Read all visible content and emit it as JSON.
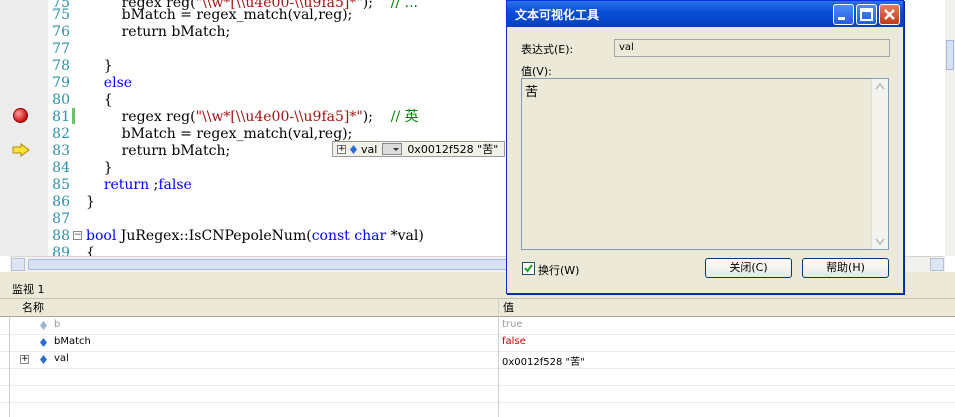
{
  "editor": {
    "lines": [
      {
        "num": "75",
        "pre": "        regex reg(",
        "str": "\"\\\\w*[\\\\u4e00-\\\\u9fa5]*\"",
        "post": ");    ",
        "cm": "// ..."
      },
      {
        "num": "75",
        "pre": "        bMatch = regex_match(val,reg);"
      },
      {
        "num": "76",
        "pre": "        return bMatch;"
      },
      {
        "num": "77",
        "pre": ""
      },
      {
        "num": "78",
        "pre": "    }"
      },
      {
        "num": "79",
        "kw": "    else"
      },
      {
        "num": "80",
        "pre": "    {"
      },
      {
        "num": "81",
        "pre": "        regex reg(",
        "str": "\"\\\\w*[\\\\u4e00-\\\\u9fa5]*\"",
        "post": ");    ",
        "cm": "// 英"
      },
      {
        "num": "82",
        "pre": "        bMatch = regex_match(val,reg);"
      },
      {
        "num": "83",
        "pre": "        return bMatch;"
      },
      {
        "num": "84",
        "pre": "    }"
      },
      {
        "num": "85",
        "kwpre": "    ",
        "kw2": "return",
        "post": " ",
        "kw3": "false",
        "post2": ";"
      },
      {
        "num": "86",
        "pre": "}"
      },
      {
        "num": "87",
        "pre": ""
      },
      {
        "num": "88",
        "kw": "bool",
        "post": " JuRegex::IsCNPepoleNum(",
        "kw2": "const",
        "post2": " ",
        "kw3": "char",
        "post3": " *val)"
      },
      {
        "num": "89",
        "pre": "{"
      }
    ]
  },
  "datatip": {
    "name": "val",
    "value": "0x0012f528 \"苦\""
  },
  "watch": {
    "title": "监视 1",
    "col_name": "名称",
    "col_value": "值",
    "rows": [
      {
        "name": "b",
        "value": "true",
        "expandable": false,
        "grey": true,
        "red": false
      },
      {
        "name": "bMatch",
        "value": "false",
        "expandable": false,
        "grey": false,
        "red": true
      },
      {
        "name": "val",
        "value": "0x0012f528 \"苦\"",
        "expandable": true,
        "grey": false,
        "red": false
      }
    ]
  },
  "dialog": {
    "title": "文本可视化工具",
    "expr_label": "表达式(E):",
    "expr_value": "val",
    "value_label": "值(V):",
    "value_text": "苦",
    "wrap_label": "换行(W)",
    "wrap_checked": true,
    "close_label": "关闭(C)",
    "help_label": "帮助(H)"
  },
  "colors": {
    "title_bar": "#0a4fd6",
    "keyword": "#0000ff",
    "string": "#a31515",
    "comment": "#008000",
    "line_number": "#2b91af",
    "watch_false": "#cc0000"
  }
}
